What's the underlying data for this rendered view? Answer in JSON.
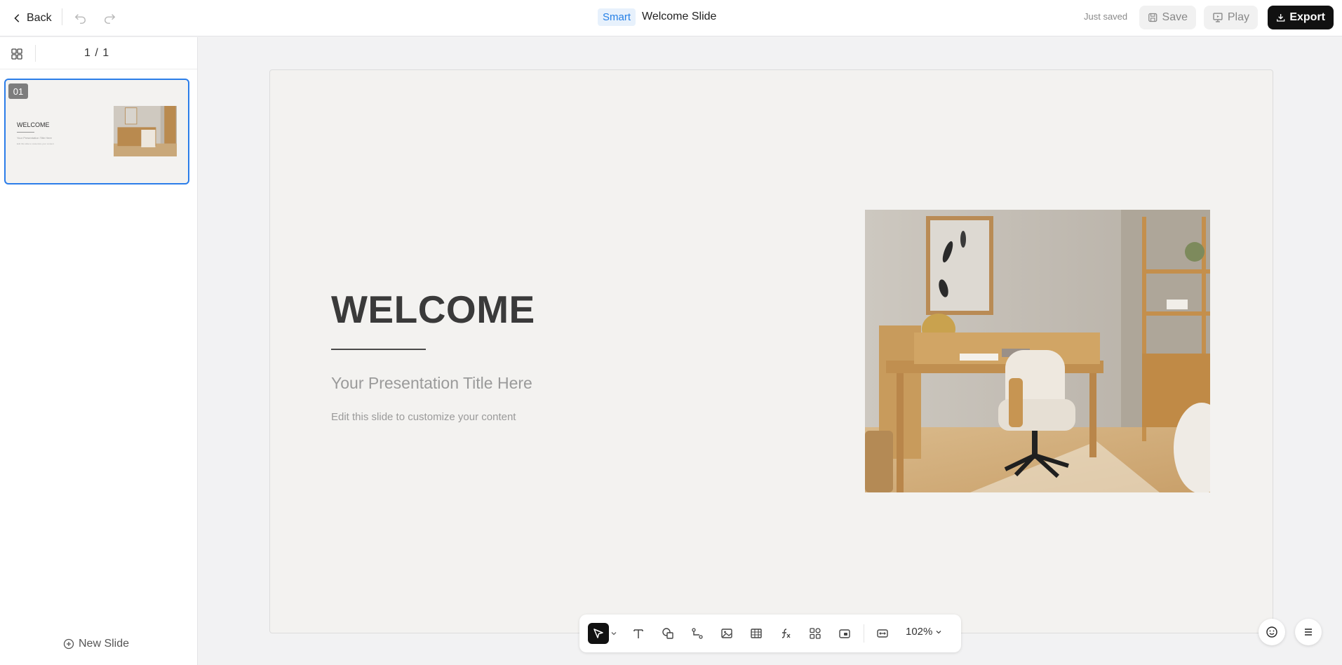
{
  "header": {
    "back_label": "Back",
    "smart_badge": "Smart",
    "doc_title": "Welcome Slide",
    "save_status": "Just saved",
    "save_label": "Save",
    "play_label": "Play",
    "export_label": "Export"
  },
  "sidebar": {
    "page_count": "1 / 1",
    "new_slide_label": "New Slide",
    "slides": [
      {
        "number": "01",
        "title": "WELCOME",
        "subtitle": "Your Presentation Title Here",
        "body": "Edit this slide to customize your content"
      }
    ]
  },
  "slide": {
    "title": "WELCOME",
    "subtitle": "Your Presentation Title Here",
    "body": "Edit this slide to customize your content",
    "image": "home-office-photo"
  },
  "toolbar": {
    "tools": [
      "select-tool",
      "text-tool",
      "shape-tool",
      "connector-tool",
      "image-tool",
      "table-tool",
      "formula-tool",
      "component-tool",
      "media-tool",
      "fit-tool"
    ],
    "zoom": "102%"
  },
  "colors": {
    "accent": "#2b7de9",
    "export_bg": "#111111",
    "slide_bg": "#f3f2f0"
  }
}
